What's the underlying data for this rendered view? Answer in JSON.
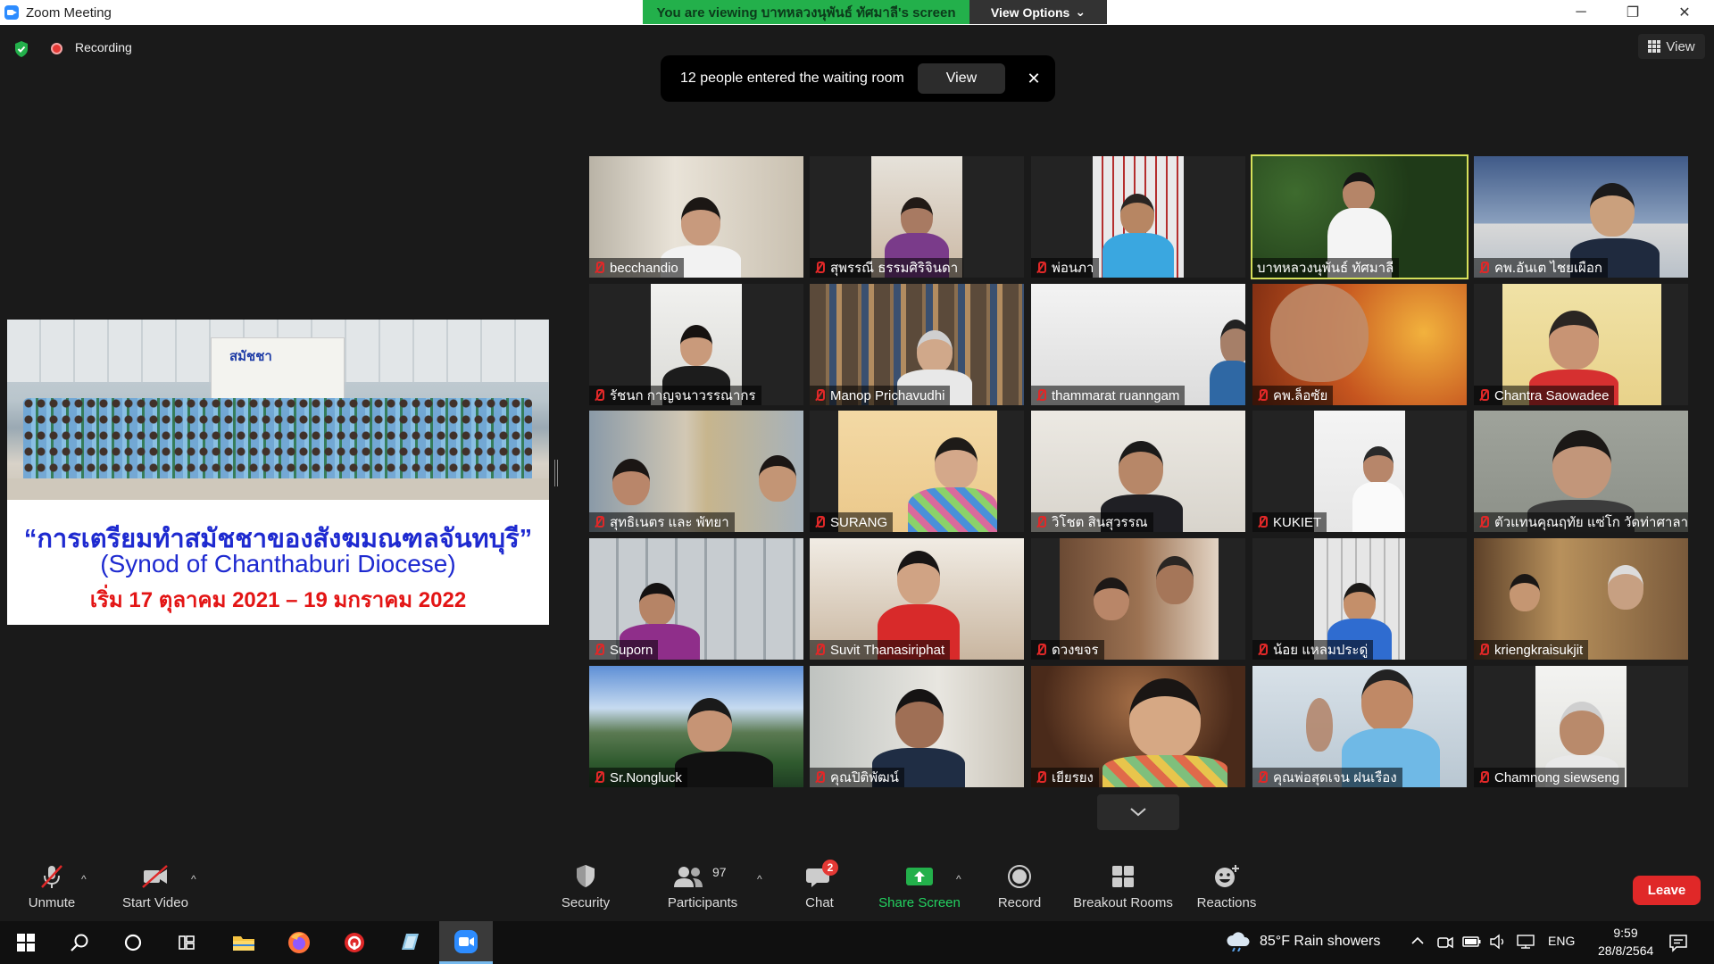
{
  "window": {
    "title": "Zoom Meeting",
    "minimize": "─",
    "restore": "❐",
    "close": "✕"
  },
  "share_banner": {
    "viewing_text": "You are viewing บาทหลวงนุพันธ์ ทัศมาลี's screen",
    "view_options": "View Options",
    "caret": "⌄"
  },
  "status": {
    "recording": "Recording"
  },
  "view_button": "View",
  "waiting_toast": {
    "message": "12 people entered the waiting room",
    "view": "View",
    "close": "✕"
  },
  "shared_slide": {
    "banner_title": "สมัชชา",
    "title": "“การเตรียมทำสมัชชาของสังฆมณฑลจันทบุรี”",
    "subtitle": "(Synod of Chanthaburi Diocese)",
    "date": "เริ่ม 17 ตุลาคม 2021 – 19 มกราคม 2022"
  },
  "participants_grid": [
    {
      "name": "becchandio"
    },
    {
      "name": "สุพรรณี ธรรมศิริจินดา"
    },
    {
      "name": "พ่อนภา"
    },
    {
      "name": "บาทหลวงนุพันธ์ ทัศมาลี",
      "active": true
    },
    {
      "name": "คพ.อันเต ไชยเผือก"
    },
    {
      "name": "รัชนก กาญจนาวรรณากร"
    },
    {
      "name": "Manop Prichavudhi"
    },
    {
      "name": "thammarat ruanngam"
    },
    {
      "name": "คพ.ล็อซัย"
    },
    {
      "name": "Chantra Saowadee"
    },
    {
      "name": "สุทธิเนตร และ พัทยา"
    },
    {
      "name": "SURANG"
    },
    {
      "name": "วิโชต  สินสุวรรณ"
    },
    {
      "name": "KUKIET"
    },
    {
      "name": "ตัวแทนคุณฤทัย แซ่โก วัดท่าศาลา..."
    },
    {
      "name": "Suporn"
    },
    {
      "name": "Suvit Thanasiriphat"
    },
    {
      "name": "ดวงขจร"
    },
    {
      "name": "น้อย แหลมประดู่"
    },
    {
      "name": "kriengkraisukjit"
    },
    {
      "name": "Sr.Nongluck"
    },
    {
      "name": "คุณปิติพัฒน์"
    },
    {
      "name": "เยียรยง"
    },
    {
      "name": "คุณพ่อสุดเจน ฝนเรือง"
    },
    {
      "name": "Chamnong siewseng"
    }
  ],
  "toolbar": {
    "unmute": "Unmute",
    "start_video": "Start Video",
    "security": "Security",
    "participants": "Participants",
    "participants_count": "97",
    "chat": "Chat",
    "chat_badge": "2",
    "share_screen": "Share Screen",
    "record": "Record",
    "breakout_rooms": "Breakout Rooms",
    "reactions": "Reactions",
    "leave": "Leave",
    "caret": "^"
  },
  "taskbar": {
    "weather": "85°F  Rain showers",
    "language": "ENG",
    "time": "9:59",
    "date": "28/8/2564"
  },
  "colors": {
    "accent_green": "#23b04b",
    "leave_red": "#e02828",
    "active_speaker": "#d5e05a"
  }
}
